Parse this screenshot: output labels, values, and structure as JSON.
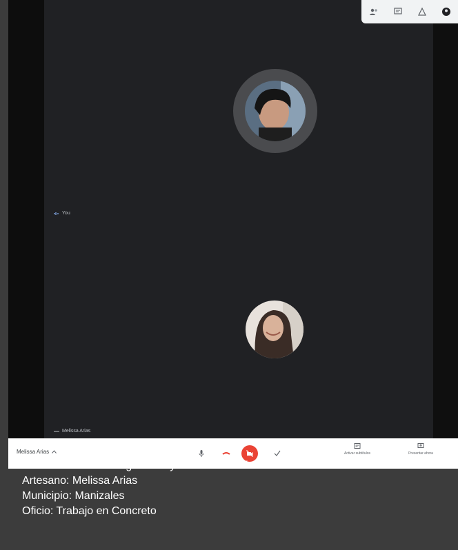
{
  "meeting": {
    "name": "Melissa Arias",
    "participant_top_label": "You",
    "participant_bottom_label": "Melissa Arias"
  },
  "controls": {
    "captions_label": "Activar subtítulos",
    "present_label": "Presentar ahora"
  },
  "colors": {
    "stage": "#202124",
    "leave_red": "#ea4335"
  },
  "icons": [
    "people-icon",
    "chat-icon",
    "activities-icon",
    "account-icon",
    "mic-icon",
    "hangup-icon",
    "camera-off-icon",
    "raise-hand-icon",
    "captions-icon",
    "present-icon"
  ],
  "caption": {
    "line1": "Asesoría Puntual Diagnostico y Caracterización",
    "line2": "Artesano: Melissa Arias",
    "line3": "Municipio: Manizales",
    "line4": "Oficio: Trabajo en Concreto"
  }
}
